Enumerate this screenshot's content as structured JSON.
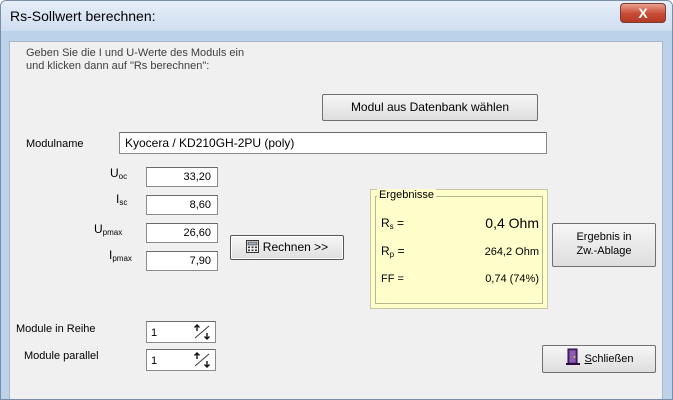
{
  "window": {
    "title": "Rs-Sollwert berechnen:",
    "close_glyph": "X"
  },
  "intro": {
    "line1": "Geben Sie die I und U-Werte des Moduls ein",
    "line2": "und klicken dann auf \"Rs berechnen\":"
  },
  "db_button_label": "Modul aus Datenbank wählen",
  "module": {
    "label": "Modulname",
    "value": "Kyocera / KD210GH-2PU (poly)"
  },
  "params": [
    {
      "main": "U",
      "sub": "oc",
      "value": "33,20"
    },
    {
      "main": "I",
      "sub": "sc",
      "value": "8,60"
    },
    {
      "main": "U",
      "sub": "pmax",
      "value": "26,60"
    },
    {
      "main": "I",
      "sub": "pmax",
      "value": "7,90"
    }
  ],
  "calc_button_label": "Rechnen >>",
  "results": {
    "legend": "Ergebnisse",
    "rs": {
      "main": "R",
      "sub": "s",
      "eq": " =",
      "value": "0,4 Ohm"
    },
    "rp": {
      "main": "R",
      "sub": "p",
      "eq": " =",
      "value": "264,2 Ohm"
    },
    "ff": {
      "label": "FF =",
      "value": "0,74 (74%)"
    }
  },
  "clipboard_button": {
    "line1": "Ergebnis in",
    "line2": "Zw.-Ablage"
  },
  "series": {
    "label": "Module in Reihe",
    "value": "1"
  },
  "parallel": {
    "label": "Module parallel",
    "value": "1"
  },
  "close_button": {
    "underline": "S",
    "rest": "chließen"
  },
  "icons": [
    "close-icon",
    "calculator-icon",
    "spin-arrows-icon",
    "door-exit-icon"
  ],
  "colors": {
    "titlebar": "#cfdef0",
    "client": "#f0f0f0",
    "results_bg": "#ffffcc",
    "close_red": "#c84a34"
  }
}
